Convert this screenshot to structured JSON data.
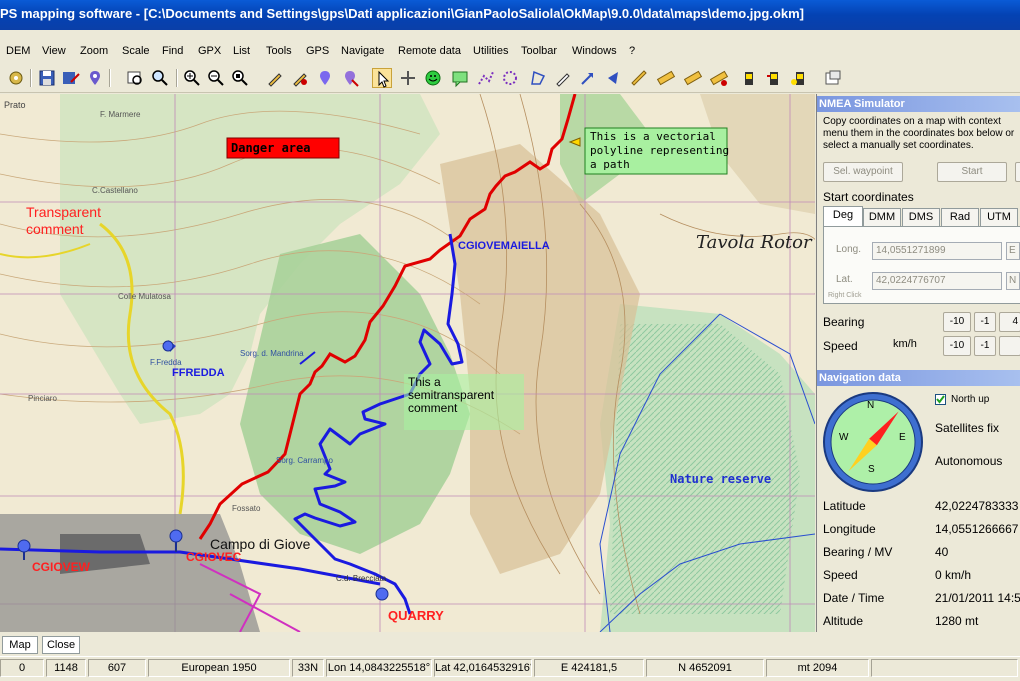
{
  "window": {
    "title": "PS mapping software - [C:\\Documents and Settings\\gps\\Dati applicazioni\\GianPaoloSaliola\\OkMap\\9.0.0\\data\\maps\\demo.jpg.okm]"
  },
  "menu": [
    "DEM",
    "View",
    "Zoom",
    "Scale",
    "Find",
    "GPX",
    "List",
    "Tools",
    "GPS",
    "Navigate",
    "Remote data",
    "Utilities",
    "Toolbar",
    "Windows",
    "?"
  ],
  "map": {
    "danger_label": "Danger area",
    "transparent_comment": "Transparent\ncomment",
    "vector_comment": "This is a vectorial\npolyline representing\na path",
    "semi_comment": "This a\nsemitransparent\ncomment",
    "nature_reserve": "Nature reserve",
    "waypoints": {
      "cgiovemaiella": "CGIOVEMAIELLA",
      "ffredda": "FFREDDA",
      "cgiovew": "CGIOVEW",
      "cgiovec": "CGIOVEC",
      "quarry": "QUARRY"
    },
    "place_labels": {
      "tavola": "Tavola Rotor",
      "campo": "Campo di Giove",
      "colle": "Colle Mulatosa",
      "castellano": "C.Castellano",
      "fredda": "F.Fredda",
      "sorg": "Sorg. d. Mandrina",
      "carranpo": "Sorg. Carrampo",
      "fossato": "Fossato",
      "marmere": "F. Marmere",
      "pinciaro": "Pinciaro",
      "brecciata": "C.d. Brecciata",
      "prato": "Prato"
    }
  },
  "nmea": {
    "header": "NMEA Simulator",
    "instructions": "Copy coordinates on a map with context menu them in the coordinates box below or select a manually set coordinates.",
    "sel_waypoint": "Sel. waypoint",
    "start": "Start",
    "start_coordinates": "Start coordinates",
    "tabs": [
      "Deg",
      "DMM",
      "DMS",
      "Rad",
      "UTM"
    ],
    "selected_tab": "Deg",
    "long_label": "Long.",
    "long_value": "14,0551271899",
    "long_suffix": "E",
    "lat_label": "Lat.",
    "lat_value": "42,0224776707",
    "lat_suffix": "N",
    "right_click": "Right Click",
    "bearing_label": "Bearing",
    "speed_label": "Speed",
    "speed_unit": "km/h",
    "minus10": "-10",
    "minus1": "-1",
    "bearing_extra": "4"
  },
  "nav": {
    "header": "Navigation data",
    "north_up": "North up",
    "north_up_checked": true,
    "sat_fix": "Satellites fix",
    "autonomous": "Autonomous",
    "compass": {
      "N": "N",
      "S": "S",
      "E": "E",
      "W": "W",
      "heading_deg": 40
    },
    "rows": [
      {
        "label": "Latitude",
        "value": "42,0224783333"
      },
      {
        "label": "Longitude",
        "value": "14,0551266667"
      },
      {
        "label": "Bearing / MV",
        "value": "40"
      },
      {
        "label": "Speed",
        "value": "0 km/h"
      },
      {
        "label": "Date / Time",
        "value": "21/01/2011 14:5"
      },
      {
        "label": "Altitude",
        "value": "1280 mt"
      }
    ]
  },
  "bottom_tabs": [
    "Map",
    "Close"
  ],
  "status": [
    "0",
    "1148",
    "607",
    "European 1950",
    "33N",
    "Lon 14,0843225518°",
    "Lat 42,0164532916°",
    "E 424181,5",
    "N 4652091",
    "mt 2094"
  ],
  "colors": {
    "title_bar": "#0a5bd6",
    "track_red": "#e00000",
    "track_blue": "#1a1ae0",
    "reserve": "#2a4fd0",
    "comment_fill": "#a8f0a0",
    "danger_fill": "#ff0000"
  }
}
